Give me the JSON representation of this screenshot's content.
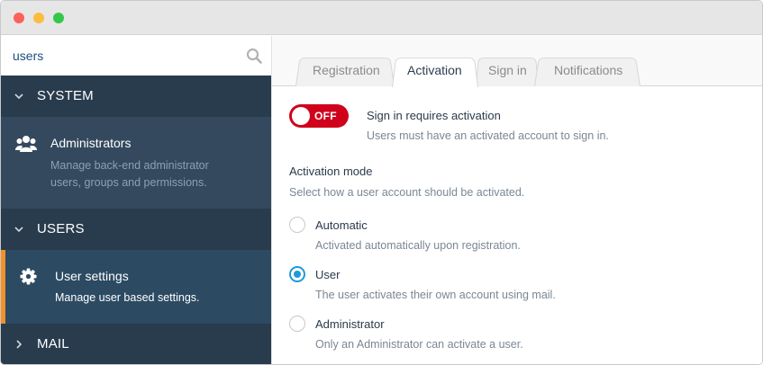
{
  "search": {
    "value": "users"
  },
  "sidebar": {
    "sections": [
      {
        "label": "SYSTEM",
        "expanded": true
      },
      {
        "label": "USERS",
        "expanded": true
      },
      {
        "label": "MAIL",
        "expanded": false
      }
    ],
    "items": [
      {
        "title": "Administrators",
        "description": "Manage back-end administrator users, groups and permissions.",
        "icon": "users-group-icon",
        "active": false
      },
      {
        "title": "User settings",
        "description": "Manage user based settings.",
        "icon": "gear-icon",
        "active": true
      }
    ],
    "active_accent": "#f0912c"
  },
  "tabs": [
    {
      "label": "Registration",
      "active": false
    },
    {
      "label": "Activation",
      "active": true
    },
    {
      "label": "Sign in",
      "active": false
    },
    {
      "label": "Notifications",
      "active": false
    }
  ],
  "form": {
    "sign_in_toggle": {
      "state": "OFF",
      "label": "Sign in requires activation",
      "help": "Users must have an activated account to sign in.",
      "color": "#d0021b"
    },
    "activation_mode": {
      "label": "Activation mode",
      "help": "Select how a user account should be activated.",
      "selected": "User",
      "options": [
        {
          "label": "Automatic",
          "help": "Activated automatically upon registration."
        },
        {
          "label": "User",
          "help": "The user activates their own account using mail."
        },
        {
          "label": "Administrator",
          "help": "Only an Administrator can activate a user."
        }
      ]
    }
  }
}
